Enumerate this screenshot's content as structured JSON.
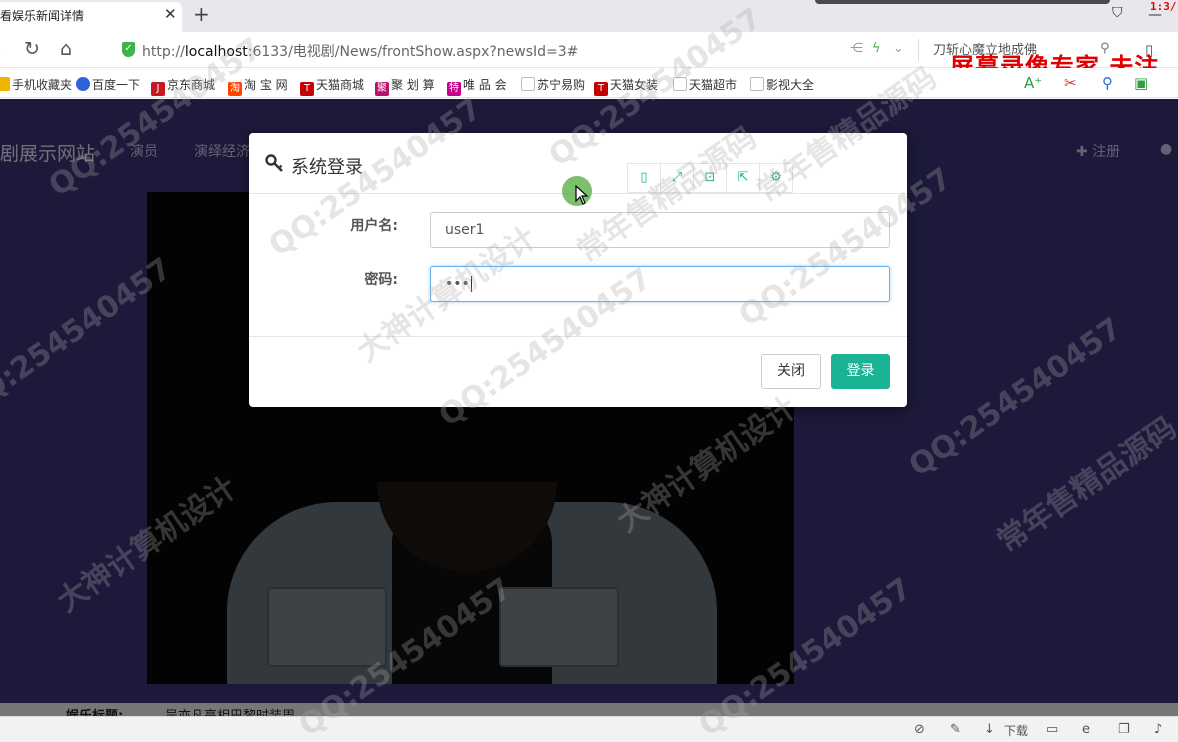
{
  "browser": {
    "tab_title": "看娱乐新闻详情",
    "tab_close": "✕",
    "new_tab": "+",
    "rec_time": "1:3/",
    "url_scheme": "http://",
    "url_host": "localhost",
    "url_rest": ":6133/电视剧/News/frontShow.aspx?newsId=3#",
    "search_text": "刀斩心魔立地成佛",
    "rec_banner": "屏幕录像专家  未注"
  },
  "bookmarks": [
    {
      "label": "手机收藏夹",
      "icon": "folder-icon",
      "color": "#f0b400"
    },
    {
      "label": "百度一下",
      "icon": "baidu-paw-icon",
      "color": "#2f63d8"
    },
    {
      "label": "京东商城",
      "icon": "jd-icon",
      "color": "#c81623"
    },
    {
      "label": "淘 宝 网",
      "icon": "taobao-icon",
      "color": "#ff4400"
    },
    {
      "label": "天猫商城",
      "icon": "tmall-icon",
      "color": "#c40000"
    },
    {
      "label": "聚 划 算",
      "icon": "juhuasuan-icon",
      "color": "#b8106b"
    },
    {
      "label": "唯 品 会",
      "icon": "vip-icon",
      "color": "#c2008a"
    },
    {
      "label": "苏宁易购",
      "icon": "page-icon",
      "color": "#999999"
    },
    {
      "label": "天猫女装",
      "icon": "tmall-icon",
      "color": "#c40000"
    },
    {
      "label": "天猫超市",
      "icon": "page-icon",
      "color": "#999999"
    },
    {
      "label": "影视大全",
      "icon": "page-icon",
      "color": "#999999"
    }
  ],
  "site": {
    "title": "剧展示网站",
    "nav": [
      "演员",
      "演绎经济"
    ],
    "register": "注册",
    "news_label": "娱乐标题:",
    "news_value": "吴亦凡亮相巴黎时装周"
  },
  "modal": {
    "title": "系统登录",
    "username_label": "用户名:",
    "username_value": "user1",
    "password_label": "密码:",
    "password_value": "•••",
    "close_label": "关闭",
    "login_label": "登录",
    "accent": "#1ab394"
  },
  "statusbar": {
    "download_label": "下载"
  },
  "watermark": {
    "qq": "QQ:254540457",
    "text1": "大神计算机设计",
    "text2": "常年售精品源码"
  }
}
